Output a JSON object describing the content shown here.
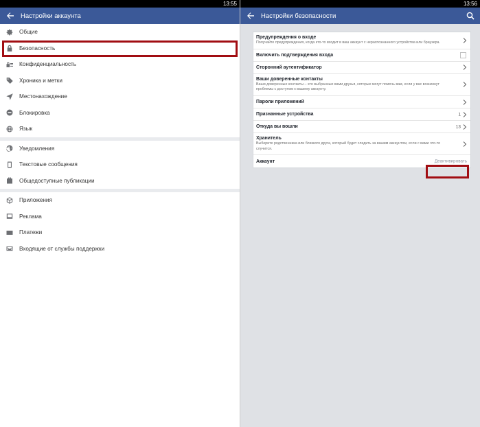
{
  "left": {
    "status_time": "13:55",
    "title": "Настройки аккаунта",
    "groups": [
      [
        {
          "label": "Общие",
          "icon": "gear-icon"
        },
        {
          "label": "Безопасность",
          "icon": "lock-icon"
        },
        {
          "label": "Конфиденциальность",
          "icon": "privacy-lock-icon"
        },
        {
          "label": "Хроника и метки",
          "icon": "tag-icon"
        },
        {
          "label": "Местонахождение",
          "icon": "location-arrow-icon"
        },
        {
          "label": "Блокировка",
          "icon": "block-icon"
        },
        {
          "label": "Язык",
          "icon": "globe-icon"
        }
      ],
      [
        {
          "label": "Уведомления",
          "icon": "globe-notifications-icon"
        },
        {
          "label": "Текстовые сообщения",
          "icon": "phone-icon"
        },
        {
          "label": "Общедоступные публикации",
          "icon": "public-posts-icon"
        }
      ],
      [
        {
          "label": "Приложения",
          "icon": "cube-icon"
        },
        {
          "label": "Реклама",
          "icon": "ad-icon"
        },
        {
          "label": "Платежи",
          "icon": "card-icon"
        },
        {
          "label": "Входящие от службы поддержки",
          "icon": "envelope-icon"
        }
      ]
    ]
  },
  "right": {
    "status_time": "13:56",
    "title": "Настройки безопасности",
    "rows": [
      {
        "title": "Предупреждения о входе",
        "desc": "Получайте предупреждения, когда кто-то входит в ваш аккаунт с нераспознанного устройства или браузера.",
        "type": "chevron"
      },
      {
        "title": "Включить подтверждения входа",
        "type": "checkbox"
      },
      {
        "title": "Сторонний аутентификатор",
        "type": "chevron"
      },
      {
        "title": "Ваши доверенные контакты",
        "desc": "Ваши доверенные контакты – это выбранные вами друзья, которые могут помочь вам, если у вас возникнут проблемы с доступом к вашему аккаунту.",
        "type": "chevron"
      },
      {
        "title": "Пароли приложений",
        "type": "chevron"
      },
      {
        "title": "Признанные устройства",
        "count": "1",
        "type": "count"
      },
      {
        "title": "Откуда вы вошли",
        "count": "13",
        "type": "count"
      },
      {
        "title": "Хранитель",
        "desc": "Выберите родственника или близкого друга, который будет следить за вашим аккаунтом, если с вами что-то случится.",
        "type": "chevron"
      },
      {
        "title": "Аккаунт",
        "action": "Деактивировать",
        "type": "action"
      }
    ]
  },
  "colors": {
    "appbar": "#3b5998",
    "highlight": "#a10d12",
    "right_bg": "#dfe1e5"
  }
}
